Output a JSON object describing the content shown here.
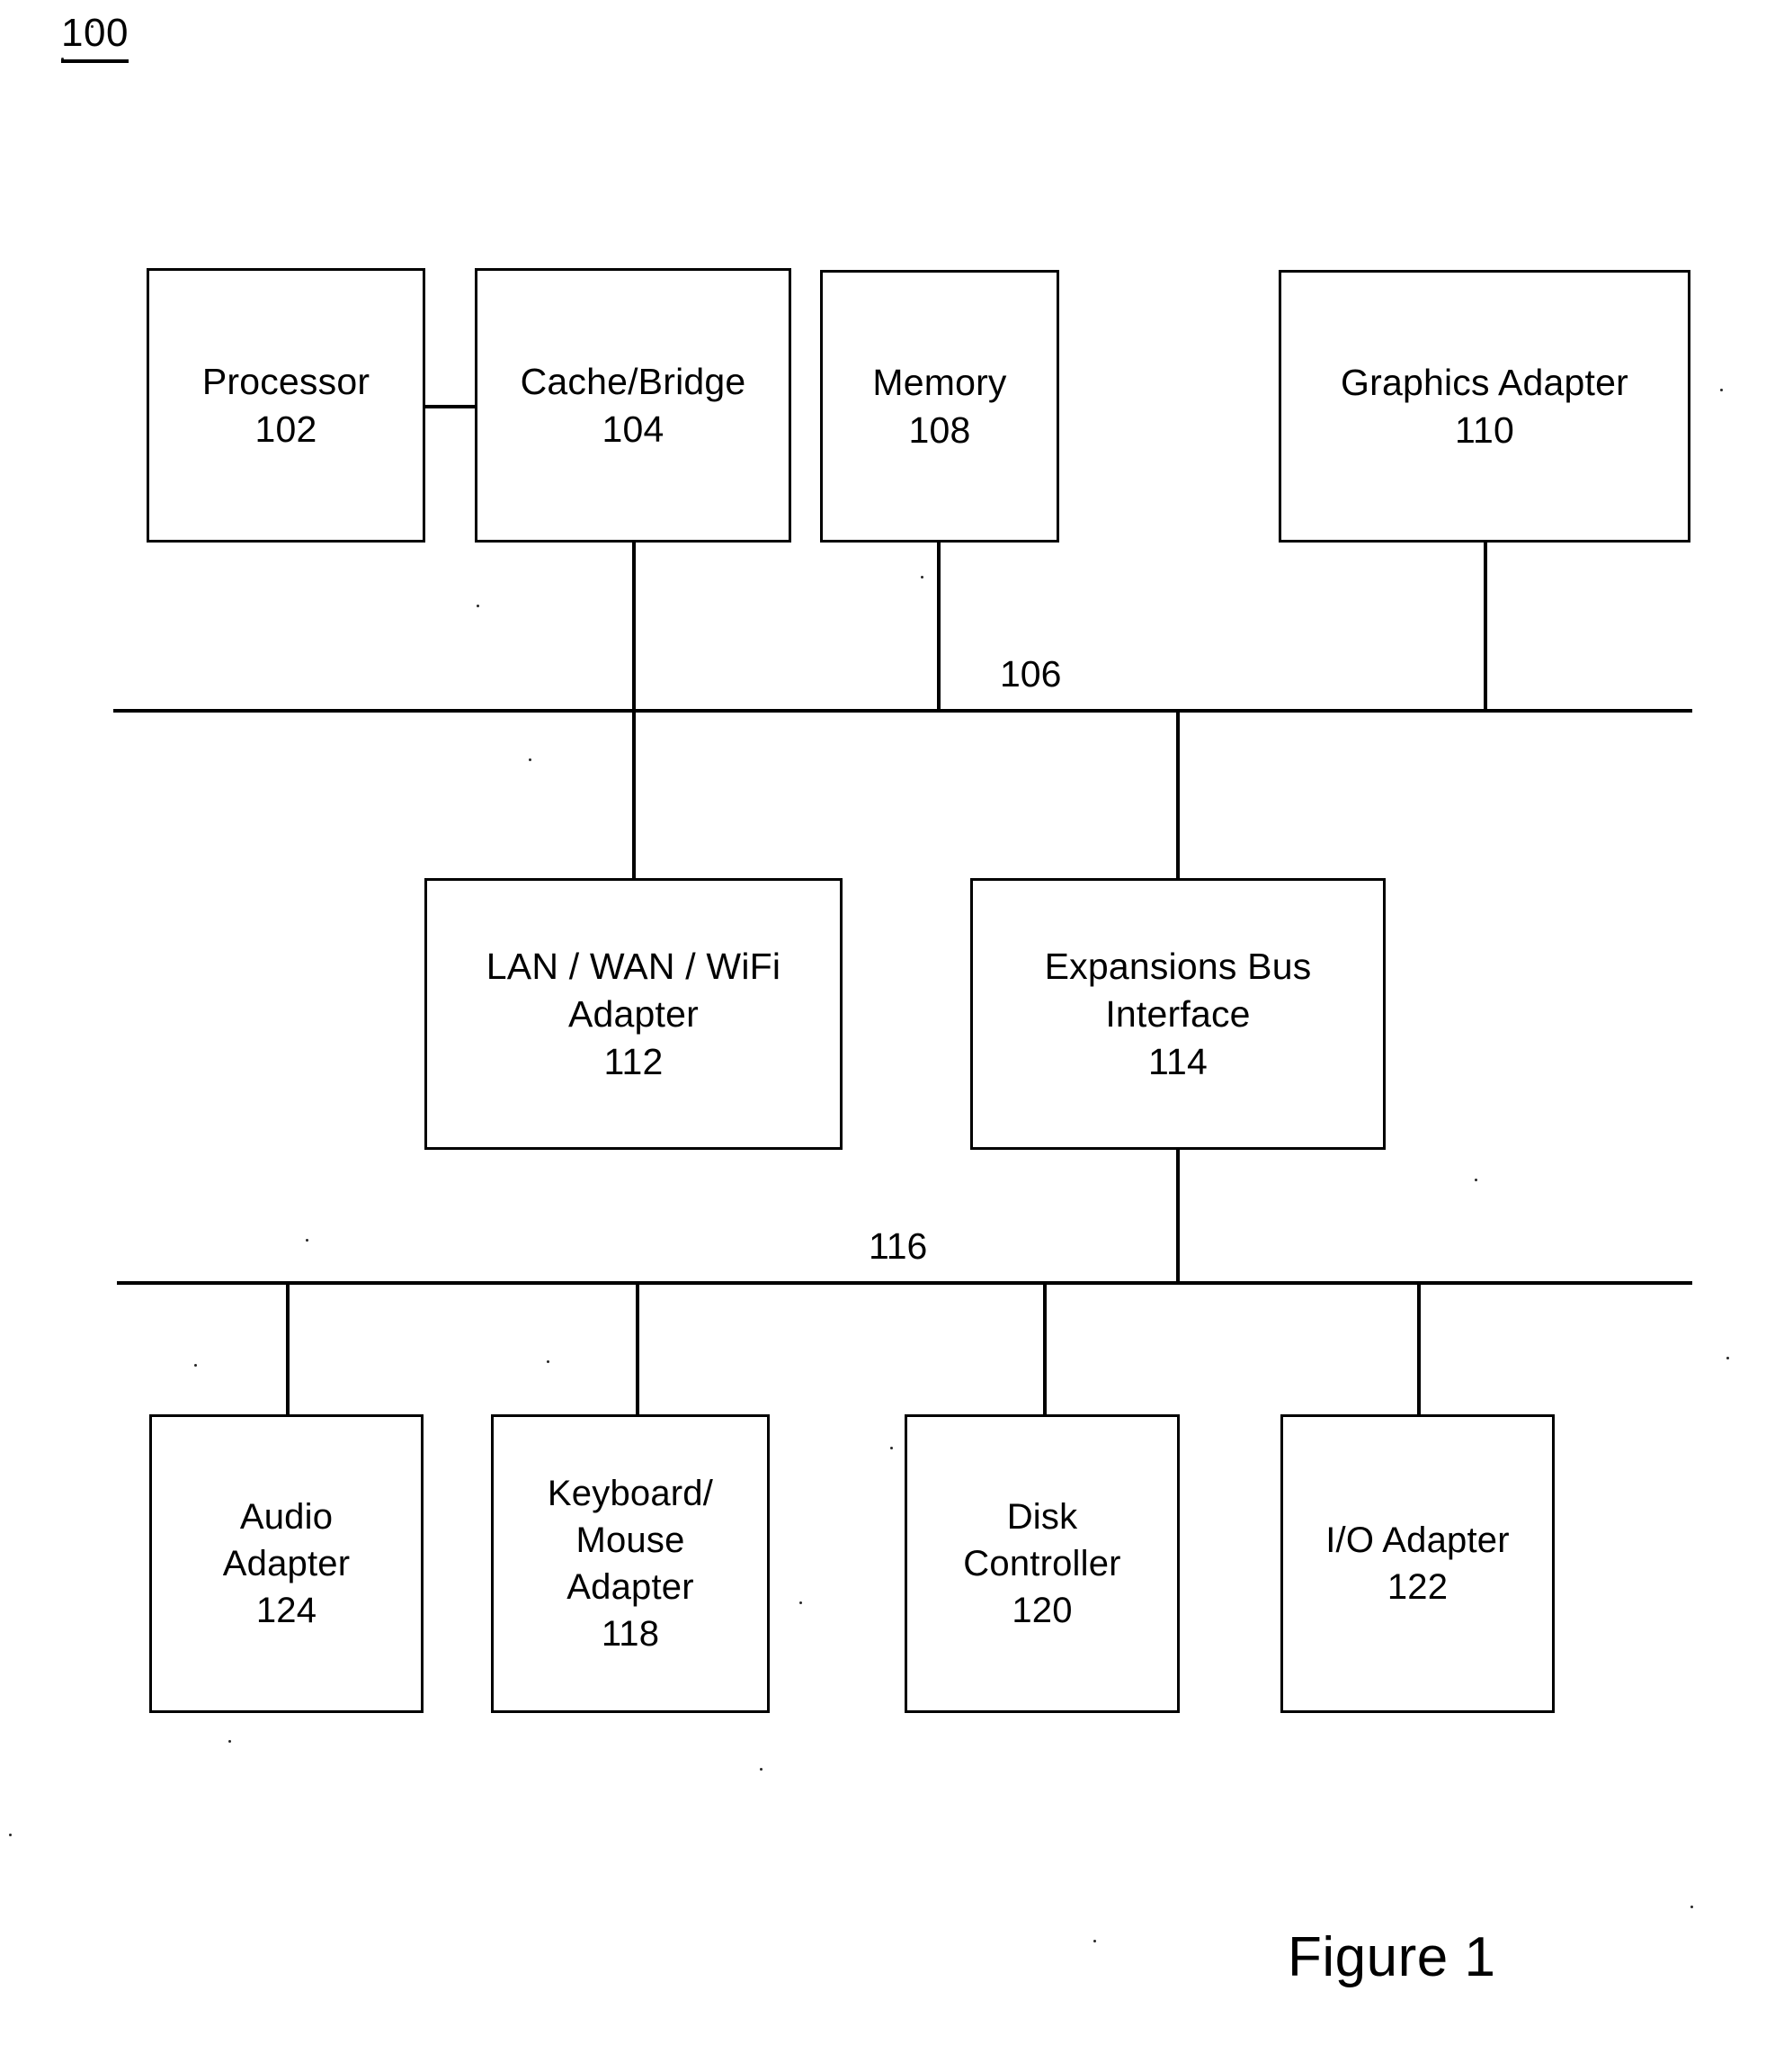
{
  "figure": {
    "reference_number": "100",
    "caption": "Figure 1"
  },
  "diagram_data": {
    "type": "diagram",
    "title": "Figure 1",
    "figure_number": "100",
    "nodes": [
      {
        "id": "102",
        "name": "Processor",
        "lines": [
          "Processor",
          "102"
        ]
      },
      {
        "id": "104",
        "name": "Cache/Bridge",
        "lines": [
          "Cache/Bridge",
          "104"
        ]
      },
      {
        "id": "108",
        "name": "Memory",
        "lines": [
          "Memory",
          "108"
        ]
      },
      {
        "id": "110",
        "name": "Graphics Adapter",
        "lines": [
          "Graphics Adapter",
          "110"
        ]
      },
      {
        "id": "112",
        "name": "LAN / WAN / WiFi Adapter",
        "lines": [
          "LAN / WAN / WiFi",
          "Adapter",
          "112"
        ]
      },
      {
        "id": "114",
        "name": "Expansions Bus Interface",
        "lines": [
          "Expansions Bus",
          "Interface",
          "114"
        ]
      },
      {
        "id": "124",
        "name": "Audio Adapter",
        "lines": [
          "Audio",
          "Adapter",
          "124"
        ]
      },
      {
        "id": "118",
        "name": "Keyboard/Mouse Adapter",
        "lines": [
          "Keyboard/",
          "Mouse",
          "Adapter",
          "118"
        ]
      },
      {
        "id": "120",
        "name": "Disk Controller",
        "lines": [
          "Disk",
          "Controller",
          "120"
        ]
      },
      {
        "id": "122",
        "name": "I/O Adapter",
        "lines": [
          "I/O Adapter",
          "122"
        ]
      }
    ],
    "buses": [
      {
        "id": "106",
        "label": "106",
        "connects": [
          "104",
          "108",
          "110",
          "112",
          "114"
        ]
      },
      {
        "id": "116",
        "label": "116",
        "connects": [
          "114",
          "124",
          "118",
          "120",
          "122"
        ]
      }
    ],
    "edges": [
      {
        "from": "102",
        "to": "104",
        "kind": "direct"
      },
      {
        "from": "104",
        "to": "106",
        "kind": "bus-drop"
      },
      {
        "from": "108",
        "to": "106",
        "kind": "bus-drop"
      },
      {
        "from": "110",
        "to": "106",
        "kind": "bus-drop"
      },
      {
        "from": "106",
        "to": "112",
        "kind": "bus-drop"
      },
      {
        "from": "106",
        "to": "114",
        "kind": "bus-drop"
      },
      {
        "from": "114",
        "to": "116",
        "kind": "bus-drop"
      },
      {
        "from": "116",
        "to": "124",
        "kind": "bus-drop"
      },
      {
        "from": "116",
        "to": "118",
        "kind": "bus-drop"
      },
      {
        "from": "116",
        "to": "120",
        "kind": "bus-drop"
      },
      {
        "from": "116",
        "to": "122",
        "kind": "bus-drop"
      }
    ]
  },
  "nodes": {
    "processor": {
      "line1": "Processor",
      "line2": "102"
    },
    "cache_bridge": {
      "line1": "Cache/Bridge",
      "line2": "104"
    },
    "memory": {
      "line1": "Memory",
      "line2": "108"
    },
    "graphics_adapter": {
      "line1": "Graphics Adapter",
      "line2": "110"
    },
    "lan_wan_wifi": {
      "line1": "LAN / WAN / WiFi",
      "line2": "Adapter",
      "line3": "112"
    },
    "expansions_bus": {
      "line1": "Expansions Bus",
      "line2": "Interface",
      "line3": "114"
    },
    "audio_adapter": {
      "line1": "Audio",
      "line2": "Adapter",
      "line3": "124"
    },
    "keyboard_mouse": {
      "line1": "Keyboard/",
      "line2": "Mouse",
      "line3": "Adapter",
      "line4": "118"
    },
    "disk_controller": {
      "line1": "Disk",
      "line2": "Controller",
      "line3": "120"
    },
    "io_adapter": {
      "line1": "I/O Adapter",
      "line2": "122"
    }
  },
  "buses": {
    "system_bus": {
      "label": "106"
    },
    "expansion_bus": {
      "label": "116"
    }
  },
  "colors": {
    "ink": "#000000",
    "paper": "#ffffff"
  }
}
